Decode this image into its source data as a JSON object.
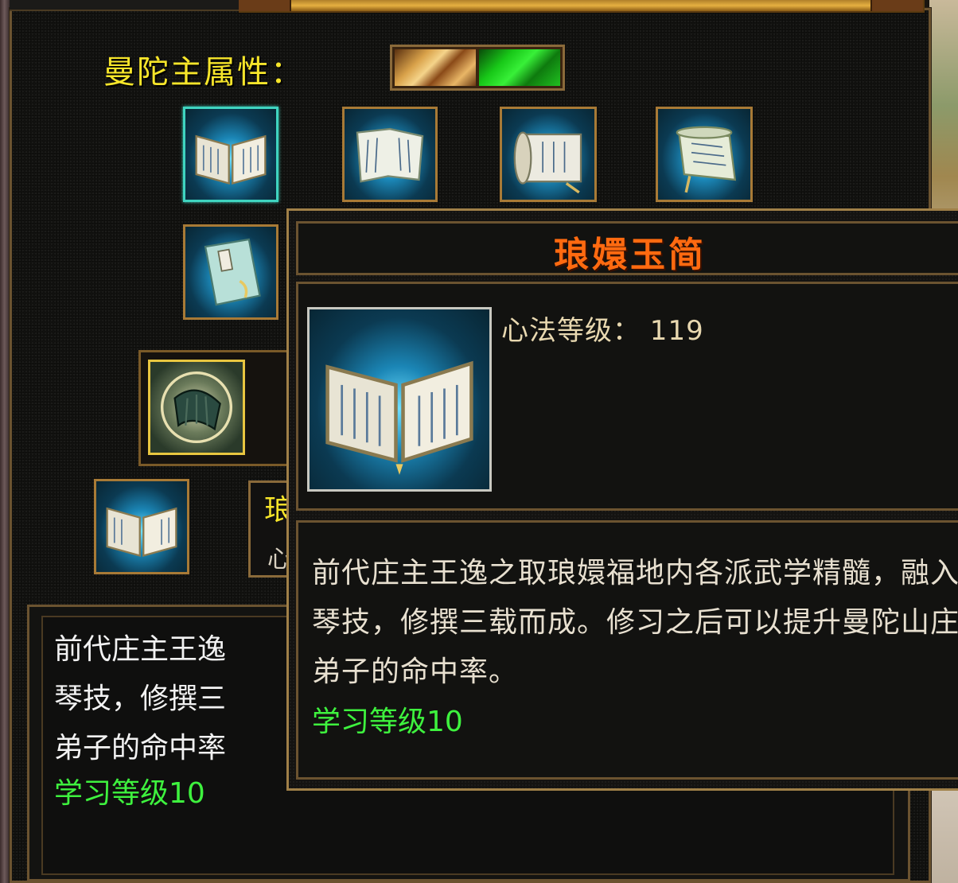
{
  "attribute": {
    "label": "曼陀主属性：",
    "elements": [
      {
        "name": "earth-attribute",
        "color": "#d9a24a"
      },
      {
        "name": "wood-attribute",
        "color": "#18c818"
      }
    ]
  },
  "skills": {
    "grid_icons": [
      "open-book-icon",
      "scroll-book-icon",
      "rolled-scroll-icon",
      "unrolled-scroll-icon",
      "manual-book-icon"
    ],
    "special_icon": "jade-slips-icon",
    "bottom_icon": "open-book-icon",
    "partial_label_char": "琅",
    "partial_level_char": "心"
  },
  "background_text": {
    "description_lines": [
      "前代庄主王逸",
      "琴技，修撰三",
      "弟子的命中率"
    ],
    "learn_level": "学习等级10"
  },
  "tooltip": {
    "title": "琅嬛玉简",
    "level_text": "心法等级：  119",
    "description": "前代庄主王逸之取琅嬛福地内各派武学精髓，融入琴技，修撰三载而成。修习之后可以提升曼陀山庄弟子的命中率。",
    "learn_level": "学习等级10",
    "icon": "open-book-icon"
  },
  "colors": {
    "title_orange": "#ff6a10",
    "label_yellow": "#f6e52a",
    "learn_green": "#3ef23e"
  }
}
